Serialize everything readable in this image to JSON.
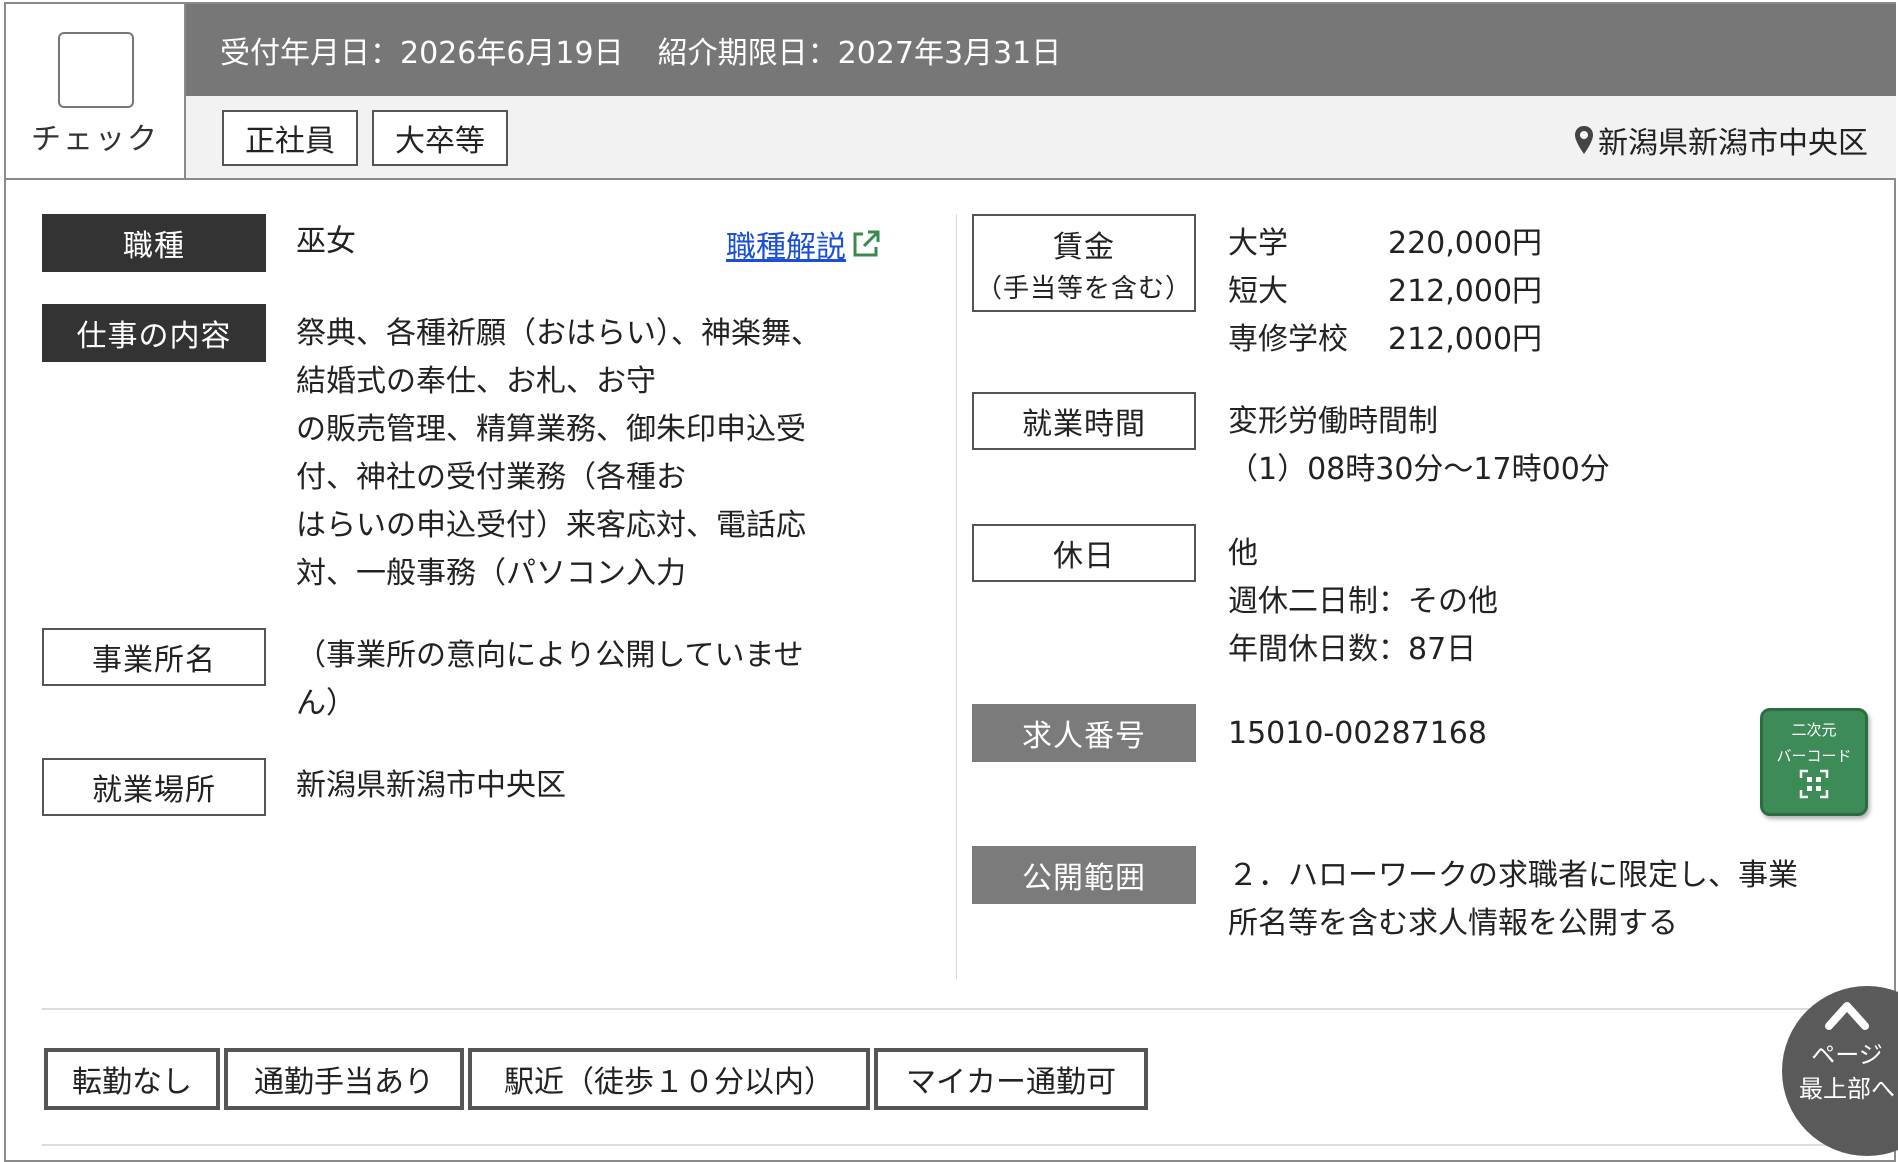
{
  "check": {
    "label": "チェック"
  },
  "header": {
    "received": "受付年月日：2026年6月19日",
    "deadline": "紹介期限日：2027年3月31日",
    "tags": [
      "正社員",
      "大卒等"
    ],
    "location": "新潟県新潟市中央区"
  },
  "left": {
    "job_type": {
      "label": "職種",
      "value": "巫女",
      "link": "職種解説"
    },
    "work_content": {
      "label": "仕事の内容",
      "lines": [
        "祭典、各種祈願（おはらい）、神楽舞、",
        "結婚式の奉仕、お札、お守",
        "の販売管理、精算業務、御朱印申込受",
        "付、神社の受付業務（各種お",
        "はらいの申込受付）来客応対、電話応",
        "対、一般事務（パソコン入力"
      ]
    },
    "office_name": {
      "label": "事業所名",
      "lines": [
        "（事業所の意向により公開していませ",
        "ん）"
      ]
    },
    "work_place": {
      "label": "就業場所",
      "value": "新潟県新潟市中央区"
    }
  },
  "right": {
    "wage": {
      "label": "賃金",
      "label_sub": "（手当等を含む）",
      "rows": [
        {
          "k": "大学",
          "v": "220,000円"
        },
        {
          "k": "短大",
          "v": "212,000円"
        },
        {
          "k": "専修学校",
          "v": "212,000円"
        }
      ]
    },
    "hours": {
      "label": "就業時間",
      "lines": [
        "変形労働時間制",
        "（1）08時30分～17時00分"
      ]
    },
    "holiday": {
      "label": "休日",
      "lines": [
        "他",
        "週休二日制：その他",
        "年間休日数：87日"
      ]
    },
    "job_number": {
      "label": "求人番号",
      "value": "15010-00287168"
    },
    "scope": {
      "label": "公開範囲",
      "lines": [
        "２．ハローワークの求職者に限定し、事業",
        "所名等を含む求人情報を公開する"
      ]
    },
    "qr": {
      "line1": "二次元",
      "line2": "バーコード"
    }
  },
  "features": [
    "転勤なし",
    "通勤手当あり",
    "駅近（徒歩１０分以内）",
    "マイカー通勤可"
  ],
  "page_top": {
    "line1": "ページ",
    "line2": "最上部へ"
  },
  "colors": {
    "header_bar": "#777777",
    "dark_label": "#333333",
    "gray_label": "#7b7b7b",
    "link": "#1a4fd6",
    "qr_green": "#3d8b57"
  }
}
